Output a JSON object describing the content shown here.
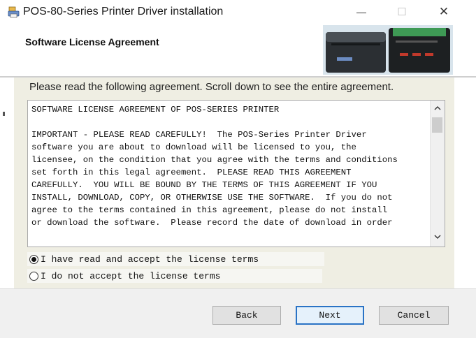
{
  "window": {
    "title": "POS-80-Series Printer Driver installation",
    "controls": {
      "minimize": "—",
      "maximize": "☐",
      "close": "✕"
    }
  },
  "header": {
    "title": "Software License Agreement",
    "image": "printer-photos"
  },
  "instruction": "Please read the following agreement. Scroll down to see the entire agreement.",
  "license": {
    "text": "SOFTWARE LICENSE AGREEMENT OF POS-SERIES PRINTER\n\nIMPORTANT - PLEASE READ CAREFULLY!  The POS-Series Printer Driver\nsoftware you are about to download will be licensed to you, the\nlicensee, on the condition that you agree with the terms and conditions\nset forth in this legal agreement.  PLEASE READ THIS AGREEMENT\nCAREFULLY.  YOU WILL BE BOUND BY THE TERMS OF THIS AGREEMENT IF YOU\nINSTALL, DOWNLOAD, COPY, OR OTHERWISE USE THE SOFTWARE.  If you do not\nagree to the terms contained in this agreement, please do not install\nor download the software.  Please record the date of download in order"
  },
  "options": {
    "accept": {
      "label": "I have read and accept the license terms",
      "checked": true
    },
    "decline": {
      "label": "I do not accept the license terms",
      "checked": false
    }
  },
  "buttons": {
    "back": "Back",
    "next": "Next",
    "cancel": "Cancel"
  },
  "colors": {
    "accent": "#2a73c5",
    "body_bg": "#efeee3"
  }
}
